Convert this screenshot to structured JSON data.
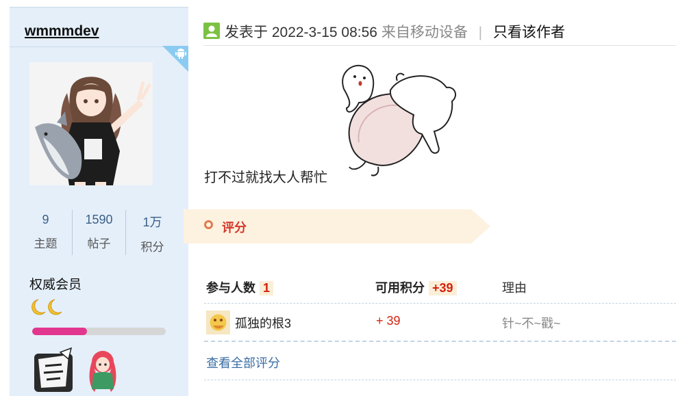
{
  "sidebar": {
    "username": "wmmmdev",
    "stats": [
      {
        "value": "9",
        "label": "主题"
      },
      {
        "value": "1590",
        "label": "帖子"
      },
      {
        "value": "1万",
        "label": "积分"
      }
    ],
    "group_title": "权威会员",
    "level_progress": 0.41,
    "colors": {
      "progress": "#e2378f",
      "panel": "#e5effa"
    }
  },
  "post": {
    "posted_label": "发表于",
    "datetime": "2022-3-15 08:56",
    "device": "来自移动设备",
    "separator": "|",
    "only_author": "只看该作者",
    "text": "打不过就找大人帮忙"
  },
  "rating": {
    "title": "评分",
    "participants_label": "参与人数",
    "participants_count": "1",
    "points_label": "可用积分",
    "points_total": "+39",
    "reason_label": "理由",
    "rows": [
      {
        "name": "孤独的根3",
        "score": "+ 39",
        "reason": "针~不~戳~"
      }
    ],
    "view_all": "查看全部评分"
  },
  "icons": [
    "android-icon",
    "poster-online-icon",
    "moon-level-icon",
    "rate-circle-icon"
  ]
}
